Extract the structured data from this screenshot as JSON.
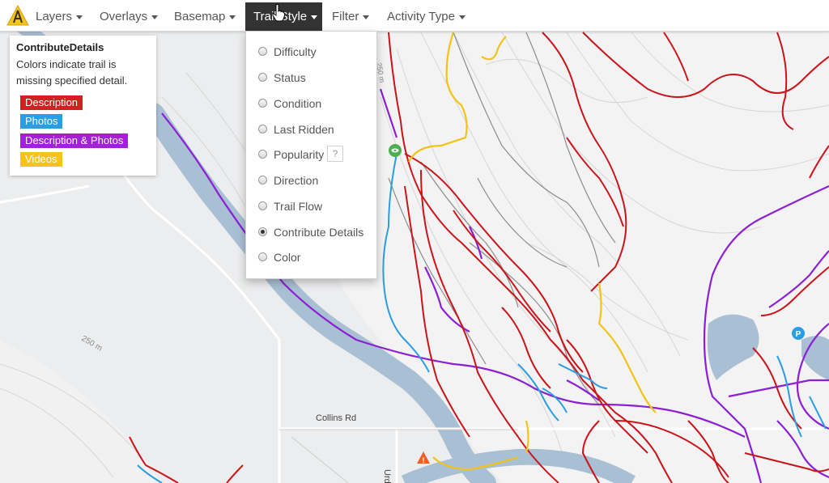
{
  "nav": {
    "logo_icon": "trailforks-logo-icon",
    "items": [
      {
        "label": "Layers"
      },
      {
        "label": "Overlays"
      },
      {
        "label": "Basemap"
      },
      {
        "label": "Trail Style",
        "active": true
      },
      {
        "label": "Filter"
      },
      {
        "label": "Activity Type"
      }
    ]
  },
  "trail_style_menu": {
    "options": [
      {
        "label": "Difficulty",
        "selected": false
      },
      {
        "label": "Status",
        "selected": false
      },
      {
        "label": "Condition",
        "selected": false
      },
      {
        "label": "Last Ridden",
        "selected": false
      },
      {
        "label": "Popularity",
        "selected": false,
        "help": "?"
      },
      {
        "label": "Direction",
        "selected": false
      },
      {
        "label": "Trail Flow",
        "selected": false
      },
      {
        "label": "Contribute Details",
        "selected": true
      },
      {
        "label": "Color",
        "selected": false
      }
    ]
  },
  "legend": {
    "title": "ContributeDetails",
    "description": "Colors indicate trail is missing specified detail.",
    "items": [
      {
        "label": "Description",
        "color": "#d12020"
      },
      {
        "label": "Photos",
        "color": "#2b9de0"
      },
      {
        "label": "Description & Photos",
        "color": "#a31fd8"
      },
      {
        "label": "Videos",
        "color": "#f6c21c"
      }
    ]
  },
  "map": {
    "road_label": "Collins Rd",
    "road_label_2": "Urd",
    "contour_label_1": "250 m",
    "contour_label_2": "250 m",
    "parking_marker": "P",
    "warning_marker": "!",
    "trail_colors": {
      "description": "#c8141a",
      "photos": "#2b9de0",
      "desc_photos": "#8b1fd3",
      "videos": "#f2c316",
      "other": "#8c8c8c",
      "water": "#a9bfd3"
    }
  }
}
